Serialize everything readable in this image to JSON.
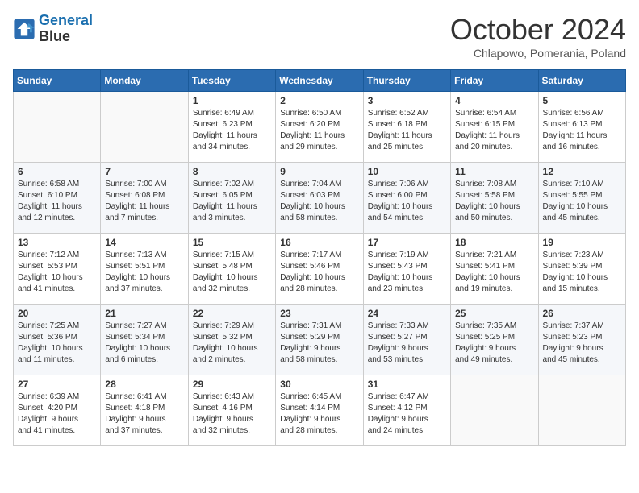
{
  "header": {
    "logo_line1": "General",
    "logo_line2": "Blue",
    "month": "October 2024",
    "location": "Chlapowo, Pomerania, Poland"
  },
  "weekdays": [
    "Sunday",
    "Monday",
    "Tuesday",
    "Wednesday",
    "Thursday",
    "Friday",
    "Saturday"
  ],
  "weeks": [
    [
      {
        "day": "",
        "detail": ""
      },
      {
        "day": "",
        "detail": ""
      },
      {
        "day": "1",
        "detail": "Sunrise: 6:49 AM\nSunset: 6:23 PM\nDaylight: 11 hours\nand 34 minutes."
      },
      {
        "day": "2",
        "detail": "Sunrise: 6:50 AM\nSunset: 6:20 PM\nDaylight: 11 hours\nand 29 minutes."
      },
      {
        "day": "3",
        "detail": "Sunrise: 6:52 AM\nSunset: 6:18 PM\nDaylight: 11 hours\nand 25 minutes."
      },
      {
        "day": "4",
        "detail": "Sunrise: 6:54 AM\nSunset: 6:15 PM\nDaylight: 11 hours\nand 20 minutes."
      },
      {
        "day": "5",
        "detail": "Sunrise: 6:56 AM\nSunset: 6:13 PM\nDaylight: 11 hours\nand 16 minutes."
      }
    ],
    [
      {
        "day": "6",
        "detail": "Sunrise: 6:58 AM\nSunset: 6:10 PM\nDaylight: 11 hours\nand 12 minutes."
      },
      {
        "day": "7",
        "detail": "Sunrise: 7:00 AM\nSunset: 6:08 PM\nDaylight: 11 hours\nand 7 minutes."
      },
      {
        "day": "8",
        "detail": "Sunrise: 7:02 AM\nSunset: 6:05 PM\nDaylight: 11 hours\nand 3 minutes."
      },
      {
        "day": "9",
        "detail": "Sunrise: 7:04 AM\nSunset: 6:03 PM\nDaylight: 10 hours\nand 58 minutes."
      },
      {
        "day": "10",
        "detail": "Sunrise: 7:06 AM\nSunset: 6:00 PM\nDaylight: 10 hours\nand 54 minutes."
      },
      {
        "day": "11",
        "detail": "Sunrise: 7:08 AM\nSunset: 5:58 PM\nDaylight: 10 hours\nand 50 minutes."
      },
      {
        "day": "12",
        "detail": "Sunrise: 7:10 AM\nSunset: 5:55 PM\nDaylight: 10 hours\nand 45 minutes."
      }
    ],
    [
      {
        "day": "13",
        "detail": "Sunrise: 7:12 AM\nSunset: 5:53 PM\nDaylight: 10 hours\nand 41 minutes."
      },
      {
        "day": "14",
        "detail": "Sunrise: 7:13 AM\nSunset: 5:51 PM\nDaylight: 10 hours\nand 37 minutes."
      },
      {
        "day": "15",
        "detail": "Sunrise: 7:15 AM\nSunset: 5:48 PM\nDaylight: 10 hours\nand 32 minutes."
      },
      {
        "day": "16",
        "detail": "Sunrise: 7:17 AM\nSunset: 5:46 PM\nDaylight: 10 hours\nand 28 minutes."
      },
      {
        "day": "17",
        "detail": "Sunrise: 7:19 AM\nSunset: 5:43 PM\nDaylight: 10 hours\nand 23 minutes."
      },
      {
        "day": "18",
        "detail": "Sunrise: 7:21 AM\nSunset: 5:41 PM\nDaylight: 10 hours\nand 19 minutes."
      },
      {
        "day": "19",
        "detail": "Sunrise: 7:23 AM\nSunset: 5:39 PM\nDaylight: 10 hours\nand 15 minutes."
      }
    ],
    [
      {
        "day": "20",
        "detail": "Sunrise: 7:25 AM\nSunset: 5:36 PM\nDaylight: 10 hours\nand 11 minutes."
      },
      {
        "day": "21",
        "detail": "Sunrise: 7:27 AM\nSunset: 5:34 PM\nDaylight: 10 hours\nand 6 minutes."
      },
      {
        "day": "22",
        "detail": "Sunrise: 7:29 AM\nSunset: 5:32 PM\nDaylight: 10 hours\nand 2 minutes."
      },
      {
        "day": "23",
        "detail": "Sunrise: 7:31 AM\nSunset: 5:29 PM\nDaylight: 9 hours\nand 58 minutes."
      },
      {
        "day": "24",
        "detail": "Sunrise: 7:33 AM\nSunset: 5:27 PM\nDaylight: 9 hours\nand 53 minutes."
      },
      {
        "day": "25",
        "detail": "Sunrise: 7:35 AM\nSunset: 5:25 PM\nDaylight: 9 hours\nand 49 minutes."
      },
      {
        "day": "26",
        "detail": "Sunrise: 7:37 AM\nSunset: 5:23 PM\nDaylight: 9 hours\nand 45 minutes."
      }
    ],
    [
      {
        "day": "27",
        "detail": "Sunrise: 6:39 AM\nSunset: 4:20 PM\nDaylight: 9 hours\nand 41 minutes."
      },
      {
        "day": "28",
        "detail": "Sunrise: 6:41 AM\nSunset: 4:18 PM\nDaylight: 9 hours\nand 37 minutes."
      },
      {
        "day": "29",
        "detail": "Sunrise: 6:43 AM\nSunset: 4:16 PM\nDaylight: 9 hours\nand 32 minutes."
      },
      {
        "day": "30",
        "detail": "Sunrise: 6:45 AM\nSunset: 4:14 PM\nDaylight: 9 hours\nand 28 minutes."
      },
      {
        "day": "31",
        "detail": "Sunrise: 6:47 AM\nSunset: 4:12 PM\nDaylight: 9 hours\nand 24 minutes."
      },
      {
        "day": "",
        "detail": ""
      },
      {
        "day": "",
        "detail": ""
      }
    ]
  ]
}
